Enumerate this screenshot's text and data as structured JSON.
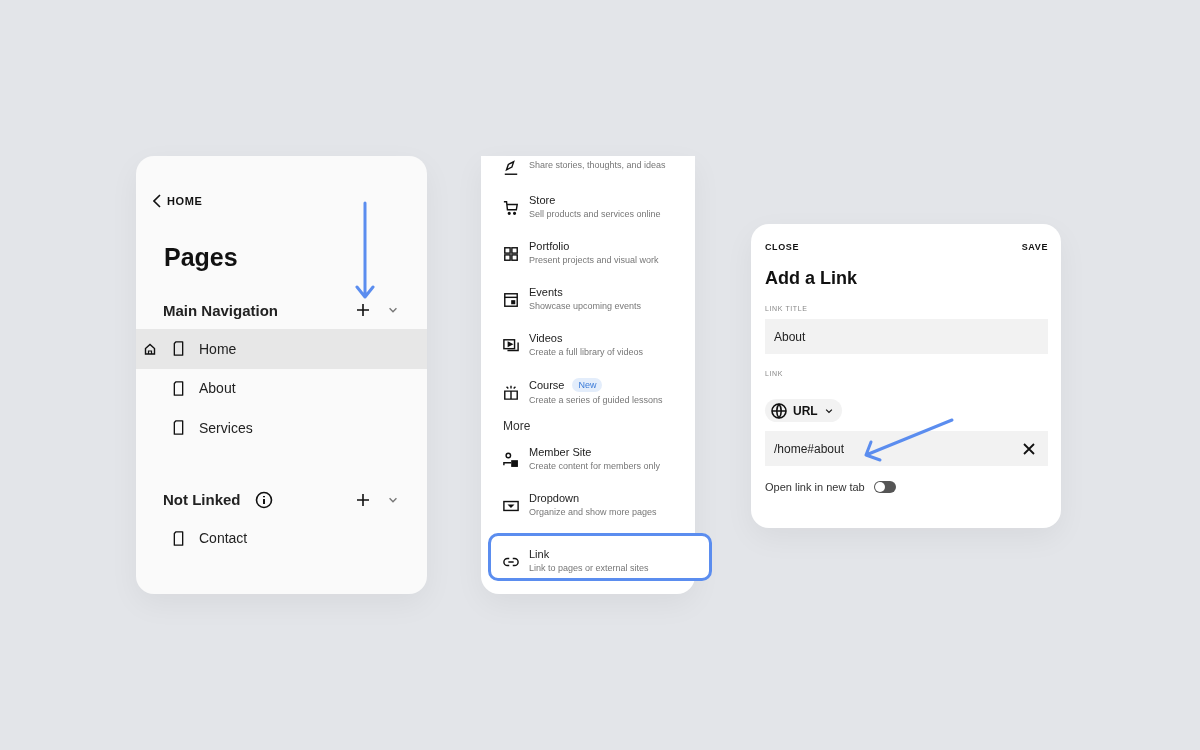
{
  "pages_panel": {
    "back_link": "HOME",
    "title": "Pages",
    "sections": [
      {
        "title": "Main Navigation",
        "info": false,
        "items": [
          {
            "label": "Home",
            "selected": true,
            "is_home": true
          },
          {
            "label": "About",
            "selected": false,
            "is_home": false
          },
          {
            "label": "Services",
            "selected": false,
            "is_home": false
          }
        ]
      },
      {
        "title": "Not Linked",
        "info": true,
        "items": [
          {
            "label": "Contact",
            "selected": false,
            "is_home": false
          }
        ]
      }
    ]
  },
  "page_types": {
    "groups": [
      {
        "items": [
          {
            "kind": "blog",
            "subtitle": "Share stories, thoughts, and ideas",
            "highlighted": false
          },
          {
            "kind": "store",
            "title": "Store",
            "subtitle": "Sell products and services online",
            "highlighted": false
          },
          {
            "kind": "portfolio",
            "title": "Portfolio",
            "subtitle": "Present projects and visual work",
            "highlighted": false
          },
          {
            "kind": "events",
            "title": "Events",
            "subtitle": "Showcase upcoming events",
            "highlighted": false
          },
          {
            "kind": "videos",
            "title": "Videos",
            "subtitle": "Create a full library of videos",
            "highlighted": false
          },
          {
            "kind": "course",
            "title": "Course",
            "badge": "New",
            "subtitle": "Create a series of guided lessons",
            "highlighted": false
          }
        ]
      },
      {
        "heading": "More",
        "items": [
          {
            "kind": "member",
            "title": "Member Site",
            "subtitle": "Create content for members only",
            "highlighted": false
          },
          {
            "kind": "dropdown",
            "title": "Dropdown",
            "subtitle": "Organize and show more pages",
            "highlighted": false
          },
          {
            "kind": "link",
            "title": "Link",
            "subtitle": "Link to pages or external sites",
            "highlighted": true
          }
        ]
      }
    ]
  },
  "link_dialog": {
    "close": "CLOSE",
    "save": "SAVE",
    "title": "Add a Link",
    "title_field": {
      "label": "LINK TITLE",
      "value": "About"
    },
    "link_label": "LINK",
    "link_type": "URL",
    "url_value": "/home#about",
    "new_tab": {
      "label": "Open link in new tab",
      "on": false
    }
  }
}
